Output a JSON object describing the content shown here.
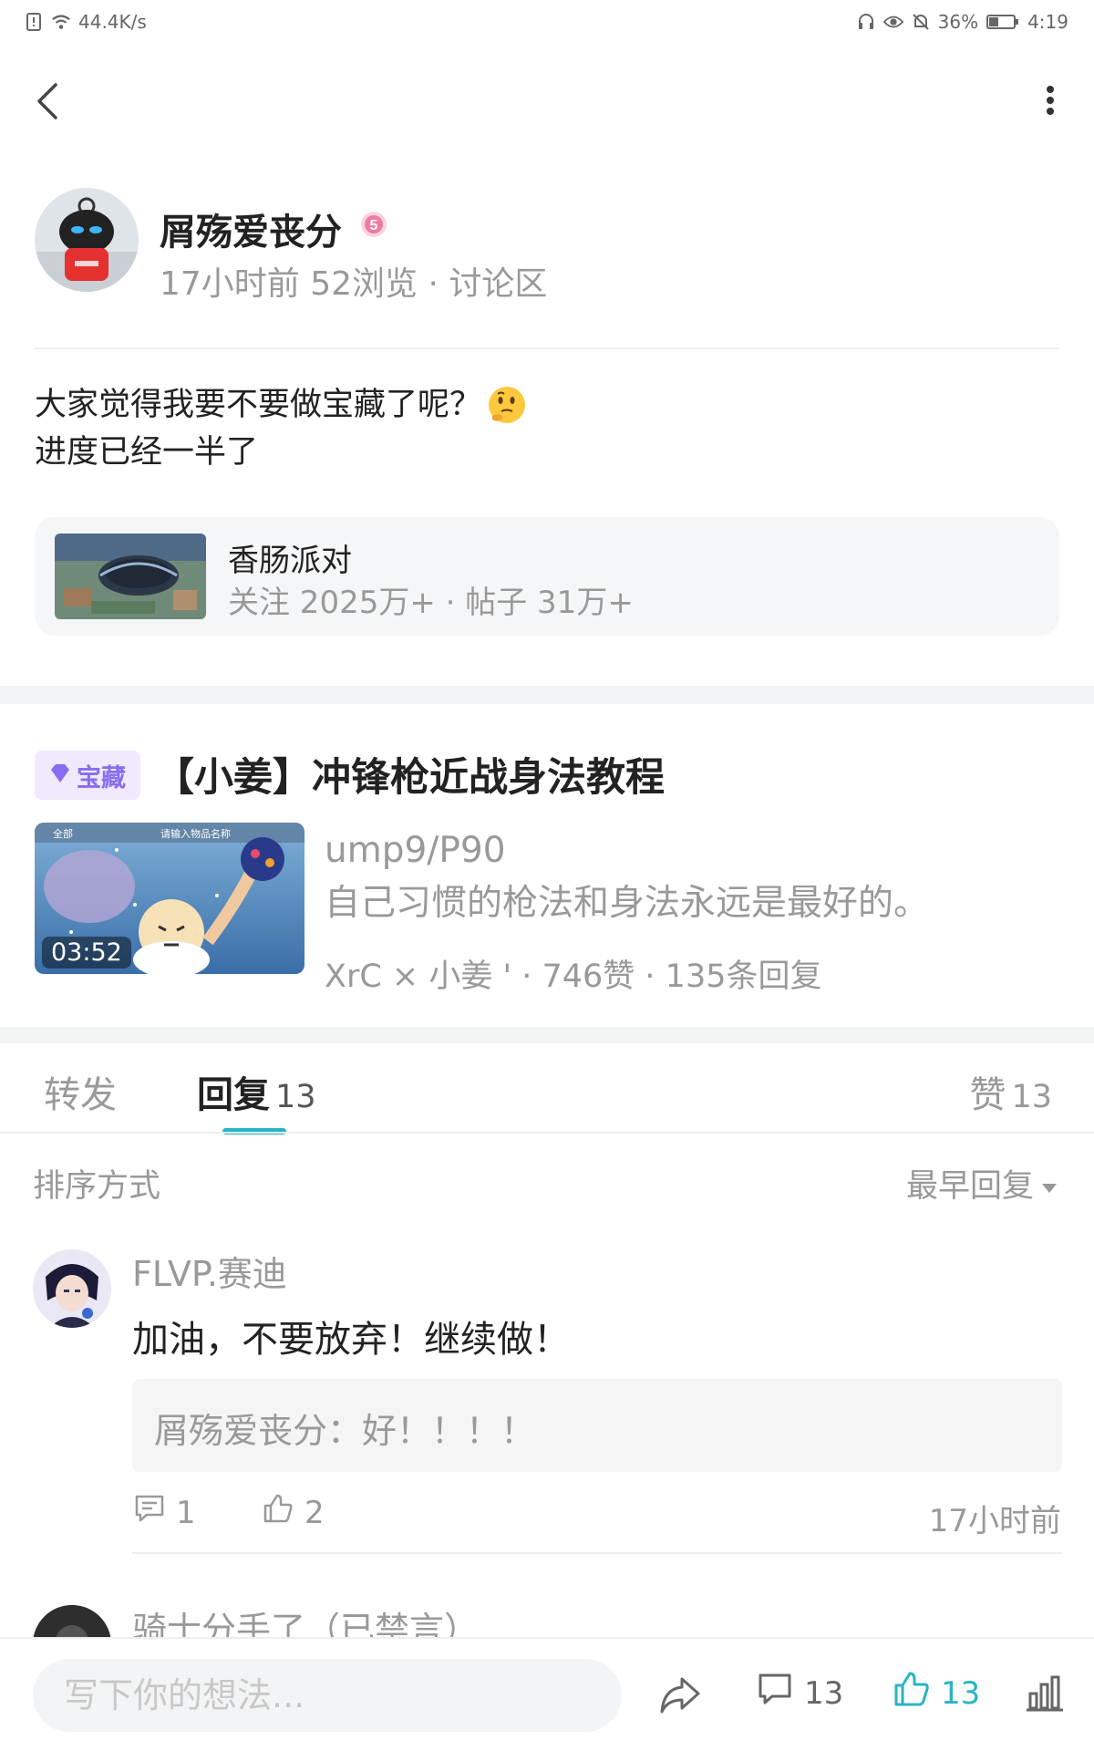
{
  "status_bar": {
    "net_speed": "44.4K/s",
    "battery": "36%",
    "time": "4:19"
  },
  "author": {
    "name": "屑殇爱丧分",
    "level": "5",
    "meta": "17小时前  52浏览 · 讨论区"
  },
  "post": {
    "line1": "大家觉得我要不要做宝藏了呢？",
    "line2": "进度已经一半了"
  },
  "topic_card": {
    "name": "香肠派对",
    "stats": "关注 2025万+ · 帖子 31万+"
  },
  "treasure": {
    "tag": "宝藏",
    "title": "【小姜】冲锋枪近战身法教程",
    "thumb_tab": "全部",
    "thumb_search": "请输入物品名称",
    "duration": "03:52",
    "subtitle1": "ump9/P90",
    "subtitle2": "自己习惯的枪法和身法永远是最好的。",
    "meta": "XrC × 小姜 ' · 746赞 · 135条回复"
  },
  "tabs": {
    "repost": "转发",
    "reply": "回复",
    "reply_count": "13",
    "like": "赞",
    "like_count": "13"
  },
  "sort": {
    "label": "排序方式",
    "value": "最早回复"
  },
  "comments": [
    {
      "user": "FLVP.赛迪",
      "text": "加油，不要放弃！继续做！",
      "reply": "屑殇爱丧分：好！！！！",
      "reply_count": "1",
      "like_count": "2",
      "time": "17小时前"
    },
    {
      "user": "骑士分手了（已禁言）"
    }
  ],
  "bottom_bar": {
    "placeholder": "写下你的想法...",
    "comment_count": "13",
    "like_count": "13"
  },
  "colors": {
    "accent": "#28b4c4",
    "treasure_purple": "#8a6cf0",
    "badge_pink": "#f07aa0"
  }
}
